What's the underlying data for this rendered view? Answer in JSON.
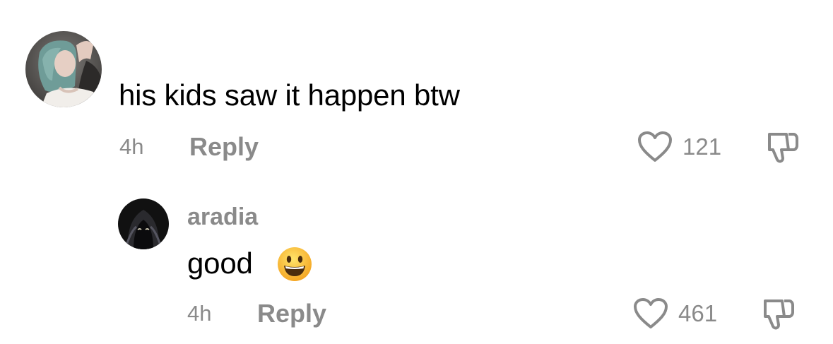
{
  "comments": [
    {
      "username": "",
      "avatar_icon": "user-avatar-photo",
      "text": "his kids saw it happen btw",
      "time": "4h",
      "reply_label": "Reply",
      "likes": "121",
      "like_icon": "heart-outline-icon",
      "dislike_icon": "thumbs-down-icon"
    }
  ],
  "replies": [
    {
      "username": "aradia",
      "avatar_icon": "user-avatar-dark",
      "text": "good",
      "emoji": "grinning-face-emoji",
      "time": "4h",
      "reply_label": "Reply",
      "likes": "461",
      "like_icon": "heart-outline-icon",
      "dislike_icon": "thumbs-down-icon"
    }
  ],
  "colors": {
    "meta_gray": "#8a8a8a",
    "text": "#000000",
    "background": "#ffffff"
  }
}
